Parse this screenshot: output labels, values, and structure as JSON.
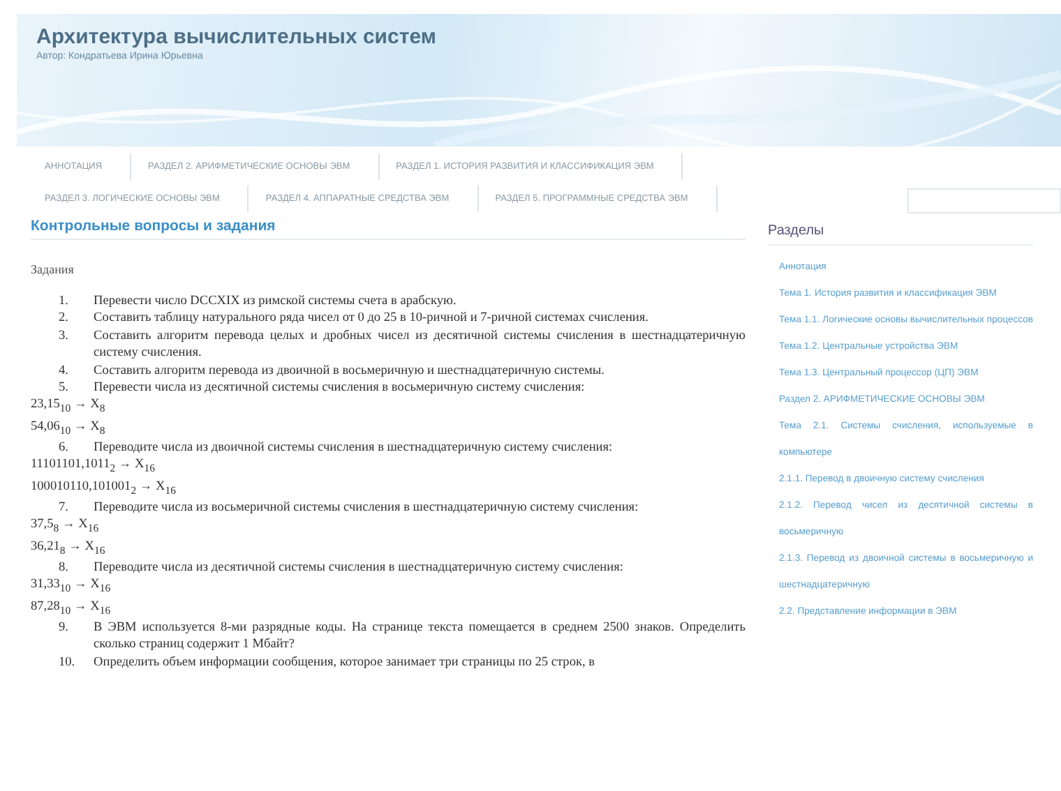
{
  "site": {
    "title": "Архитектура вычислительных систем",
    "subtitle": "Автор: Кондратьева Ирина Юрьевна"
  },
  "nav": [
    [
      {
        "label": "АННОТАЦИЯ",
        "selected": false
      },
      {
        "label": "РАЗДЕЛ 2. АРИФМЕТИЧЕСКИЕ ОСНОВЫ ЭВМ",
        "selected": false
      },
      {
        "label": "РАЗДЕЛ 1. ИСТОРИЯ РАЗВИТИЯ И КЛАССИФИКАЦИЯ ЭВМ",
        "selected": false
      }
    ],
    [
      {
        "label": "РАЗДЕЛ 3. ЛОГИЧЕСКИЕ ОСНОВЫ ЭВМ",
        "selected": false
      },
      {
        "label": "РАЗДЕЛ 4. АППАРАТНЫЕ СРЕДСТВА ЭВМ",
        "selected": false
      },
      {
        "label": "РАЗДЕЛ 5. ПРОГРАММНЫЕ СРЕДСТВА ЭВМ",
        "selected": false
      }
    ]
  ],
  "search": {
    "kind": "field"
  },
  "article": {
    "title": "Контрольные вопросы и задания",
    "subtitle": "Задания",
    "items": [
      {
        "kind": "item",
        "number": "1.",
        "text": "Перевести число DCCXIX из римской системы счета в арабскую."
      },
      {
        "kind": "item",
        "number": "2.",
        "text": "Составить таблицу натурального ряда чисел от 0 до 25 в 10-ричной и 7-ричной системах счисления."
      },
      {
        "kind": "item",
        "number": "3.",
        "text": "Составить алгоритм перевода целых и дробных чисел из десятичной системы счисления в шестнадцатеричную систему счисления."
      },
      {
        "kind": "item",
        "number": "4.",
        "text": "Составить алгоритм перевода из двоичной в восьмеричную и шестнадцатеричную системы."
      },
      {
        "kind": "item",
        "number": "5.",
        "text": "Перевести числа из десятичной системы счисления в восьмеричную систему счисления:"
      },
      {
        "kind": "formula",
        "text": "23,15$_{10}$ → X$_{8}$"
      },
      {
        "kind": "formula",
        "text": "54,06$_{10}$ → X$_{8}$"
      },
      {
        "kind": "item",
        "number": "6.",
        "text": "Переводите числа из двоичной системы счисления в шестнадцатеричную систему счисления:"
      },
      {
        "kind": "formula",
        "text": "11101101,1011$_{2}$ → X$_{16}$"
      },
      {
        "kind": "formula",
        "text": "100010110,101001$_{2}$ → X$_{16}$"
      },
      {
        "kind": "item",
        "number": "7.",
        "text": "Переводите числа из восьмеричной системы счисления в шестнадцатеричную систему счисления:"
      },
      {
        "kind": "formula",
        "text": "37,5$_{8}$ → X$_{16}$"
      },
      {
        "kind": "formula",
        "text": "36,21$_{8}$ → X$_{16}$"
      },
      {
        "kind": "item",
        "number": "8.",
        "text": "Переводите числа из десятичной системы счисления в шестнадцатеричную систему счисления:"
      },
      {
        "kind": "formula",
        "text": "31,33$_{10}$ → X$_{16}$"
      },
      {
        "kind": "formula",
        "text": "87,28$_{10}$ → X$_{16}$"
      },
      {
        "kind": "item",
        "number": "9.",
        "text": "В ЭВМ используется 8-ми разрядные коды. На странице текста помещается в среднем 2500 знаков. Определить сколько страниц содержит 1 Мбайт?"
      },
      {
        "kind": "item",
        "number": "10.",
        "text": "Определить объем информации сообщения, которое занимает три страницы по 25 строк, в"
      }
    ]
  },
  "sidebar": {
    "title": "Разделы",
    "items": [
      {
        "label": "Аннотация",
        "selected": false
      },
      {
        "label": "Тема 1. История развития и классификация ЭВМ",
        "selected": false
      },
      {
        "label": "Тема 1.1. Логические основы вычислительных процессов",
        "selected": false
      },
      {
        "label": "Тема 1.2. Центральные устройства ЭВМ",
        "selected": false
      },
      {
        "label": "Тема 1.3. Центральный процессор (ЦП) ЭВМ",
        "selected": false
      },
      {
        "label": "Раздел 2. АРИФМЕТИЧЕСКИЕ ОСНОВЫ ЭВМ",
        "selected": false
      },
      {
        "label": "Тема 2.1. Системы счисления, используемые в компьютере",
        "selected": false
      },
      {
        "label": "2.1.1. Перевод в двоичную систему счисления",
        "selected": false
      },
      {
        "label": "2.1.2. Перевод чисел из десятичной системы в восьмеричную",
        "selected": false
      },
      {
        "label": "2.1.3. Перевод из двоичной системы в восьмеричную и шестнадцатеричную",
        "selected": false
      },
      {
        "label": "2.2. Представление информации в ЭВМ",
        "selected": false
      }
    ]
  }
}
